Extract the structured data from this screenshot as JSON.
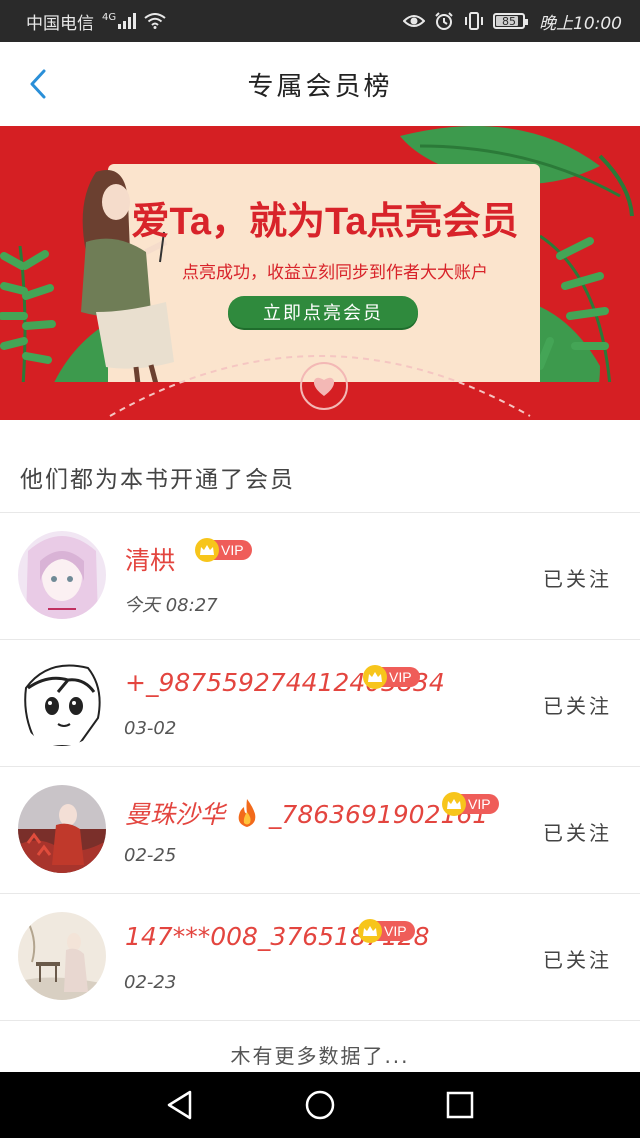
{
  "status_bar": {
    "carrier": "中国电信",
    "network": "4G",
    "battery": "85",
    "time": "晚上10:00",
    "icons": [
      "signal-icon",
      "wifi-icon",
      "eye-icon",
      "alarm-icon",
      "vibrate-icon",
      "battery-icon"
    ]
  },
  "header": {
    "title": "专属会员榜",
    "back_icon": "chevron-left-icon",
    "accent": "#2a8fd8"
  },
  "banner": {
    "headline": "爱Ta，就为Ta点亮会员",
    "subtitle": "点亮成功，收益立刻同步到作者大大账户",
    "button": "立即点亮会员",
    "colors": {
      "background": "#d51f23",
      "card": "#fbe4cd",
      "button": "#2f8a3d"
    }
  },
  "section": {
    "title": "他们都为本书开通了会员"
  },
  "members": [
    {
      "name": "清栱",
      "date": "今天 08:27",
      "badge": "VIP",
      "action": "已关注",
      "fire": false
    },
    {
      "name": "+_987559274412403834",
      "date": "03-02",
      "badge": "VIP",
      "action": "已关注",
      "fire": false
    },
    {
      "name_prefix": "曼珠沙华",
      "name_suffix": "_7863691902161",
      "date": "02-25",
      "badge": "VIP",
      "action": "已关注",
      "fire": true
    },
    {
      "name": "147***008_3765187128",
      "date": "02-23",
      "badge": "VIP",
      "action": "已关注",
      "fire": false
    }
  ],
  "footer": {
    "text": "木有更多数据了..."
  },
  "nav_bar": {
    "icons": [
      "back-triangle-icon",
      "home-circle-icon",
      "recents-square-icon"
    ]
  },
  "colors": {
    "name_red": "#e3453f",
    "vip_tag": "#ef5d59",
    "crown": "#f7c51b"
  }
}
